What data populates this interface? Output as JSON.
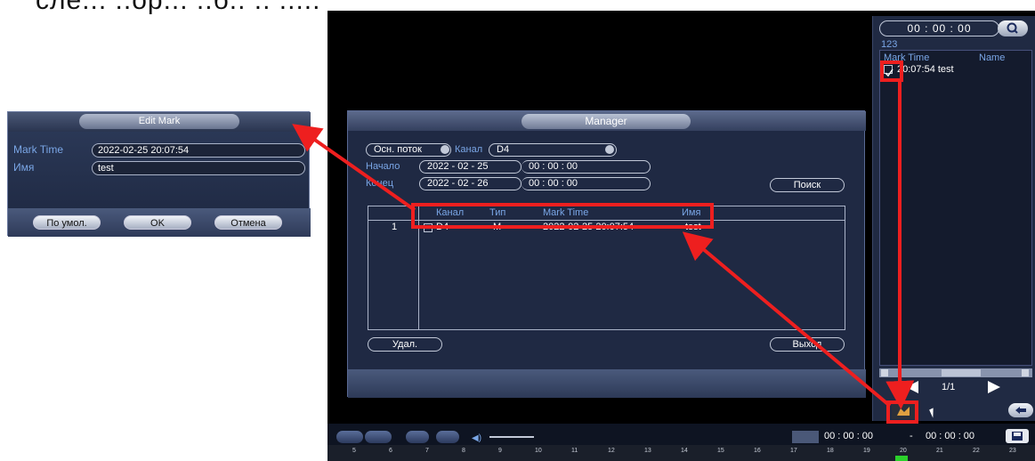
{
  "header_text": "сле... ..ор... ..б.. .. .....",
  "edit_dialog": {
    "title": "Edit Mark",
    "mark_time_label": "Mark Time",
    "mark_time_value": "2022-02-25 20:07:54",
    "name_label": "Имя",
    "name_value": "test",
    "btn_default": "По умол.",
    "btn_ok": "OK",
    "btn_cancel": "Отмена"
  },
  "manager": {
    "title": "Manager",
    "stream_value": "Осн. поток",
    "channel_label": "Канал",
    "channel_value": "D4",
    "start_label": "Начало",
    "start_date": "2022 - 02 - 25",
    "start_time": "00 : 00 : 00",
    "end_label": "Конец",
    "end_date": "2022 - 02 - 26",
    "end_time": "00 : 00 : 00",
    "search_btn": "Поиск",
    "columns": [
      "",
      "Канал",
      "Тип",
      "Mark Time",
      "Имя"
    ],
    "rows": [
      {
        "index": "1",
        "channel": "D4",
        "type": "M",
        "mark_time": "2022-02-25 20:07:54",
        "name": "test"
      }
    ],
    "delete_btn": "Удал.",
    "exit_btn": "Выход"
  },
  "right_panel": {
    "time": "00 : 00 : 00",
    "counter": "123",
    "col_mark_time": "Mark Time",
    "col_name": "Name",
    "item": "20:07:54 test",
    "page": "1/1"
  },
  "bottom_bar": {
    "time_start": "00 : 00 : 00",
    "dash": "-",
    "time_end": "00 : 00 : 00",
    "timeline_ticks": [
      "5",
      "6",
      "7",
      "8",
      "9",
      "10",
      "11",
      "12",
      "13",
      "14",
      "15",
      "16",
      "17",
      "18",
      "19",
      "20",
      "21",
      "22",
      "23"
    ]
  },
  "colors": {
    "highlight": "#ee1f1f",
    "label_blue": "#7aa6e6",
    "panel_bg": "#1f2943"
  }
}
